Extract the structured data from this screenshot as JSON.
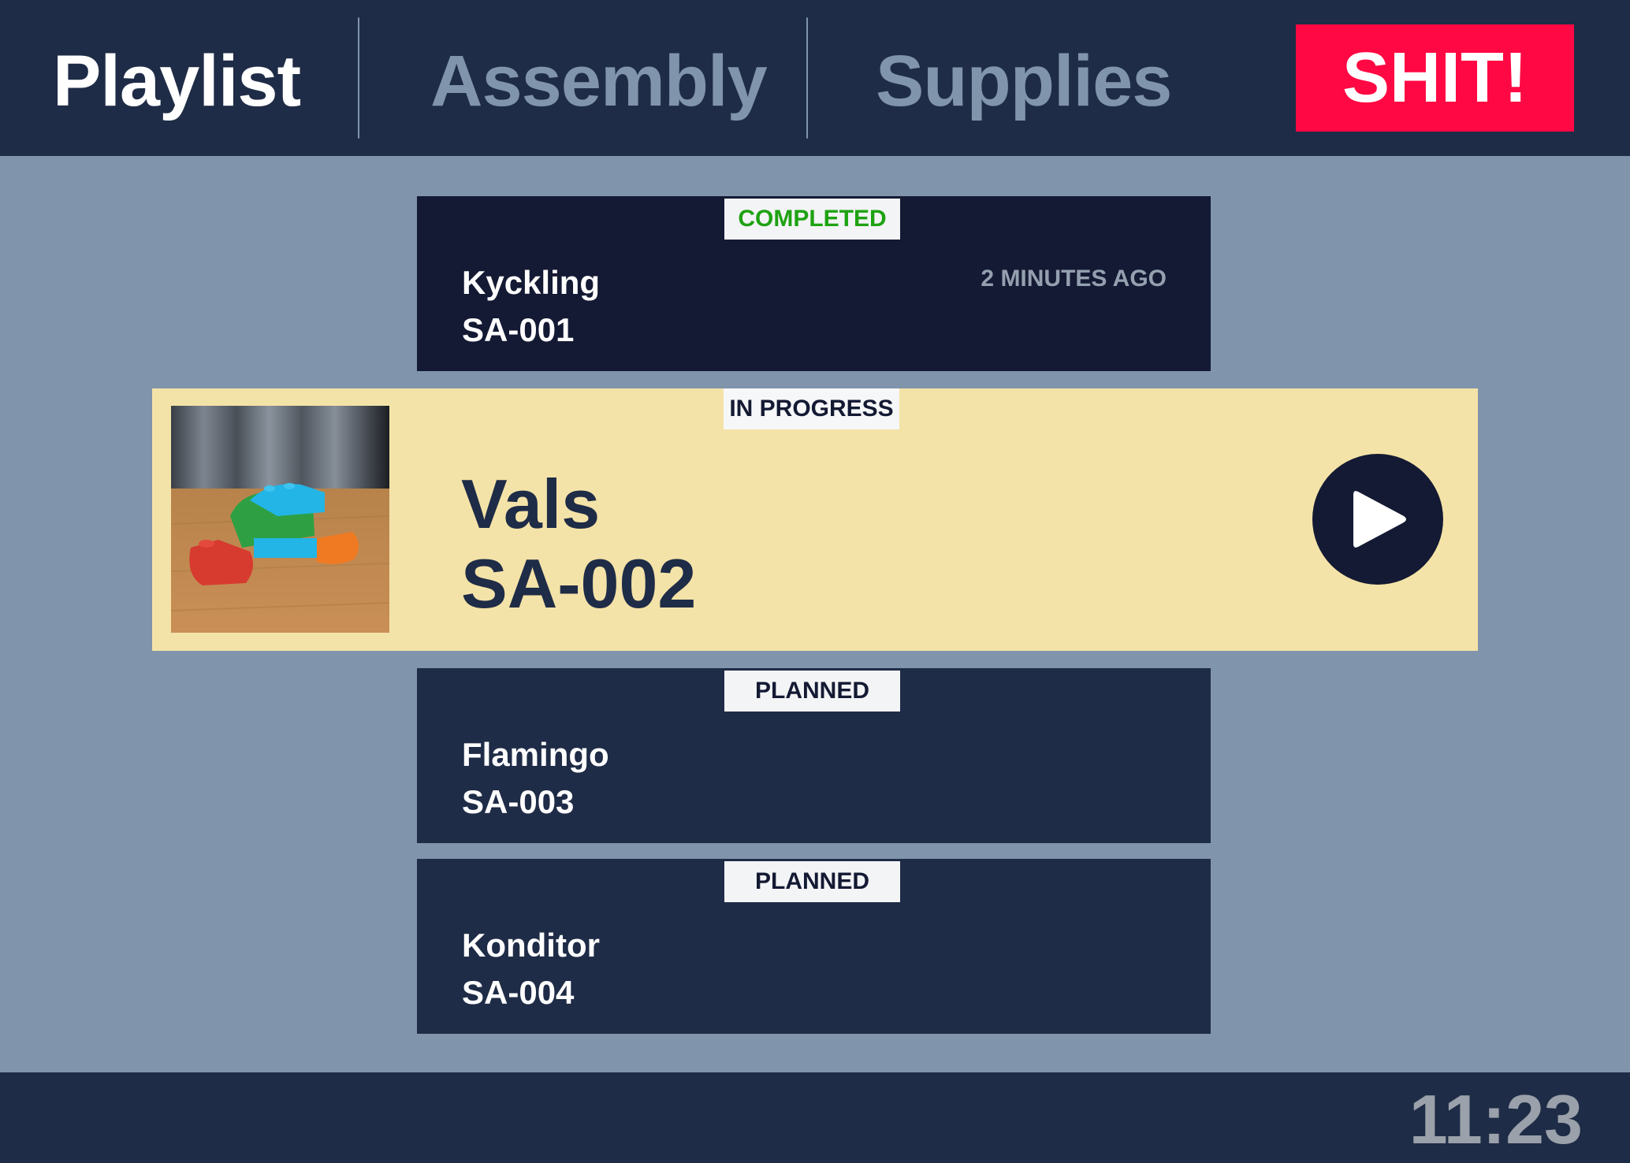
{
  "tabs": [
    {
      "label": "Playlist",
      "active": true
    },
    {
      "label": "Assembly",
      "active": false
    },
    {
      "label": "Supplies",
      "active": false
    }
  ],
  "alarm_button": {
    "label": "SHIT!",
    "color": "#ff0843"
  },
  "playlist": {
    "completed": {
      "status": "COMPLETED",
      "name": "Kyckling",
      "code": "SA-001",
      "time": "2 MINUTES AGO"
    },
    "in_progress": {
      "status": "IN PROGRESS",
      "name": "Vals",
      "code": "SA-002",
      "thumbnail_icon": "lego-model-photo",
      "action_icon": "play-icon"
    },
    "planned": [
      {
        "status": "PLANNED",
        "name": "Flamingo",
        "code": "SA-003"
      },
      {
        "status": "PLANNED",
        "name": "Konditor",
        "code": "SA-004"
      }
    ]
  },
  "footer": {
    "clock": "11:23"
  },
  "colors": {
    "header_bg": "#1f2c47",
    "page_bg": "#8094ab",
    "active_card_bg": "#f4e3a8",
    "completed_text": "#1ea212"
  }
}
